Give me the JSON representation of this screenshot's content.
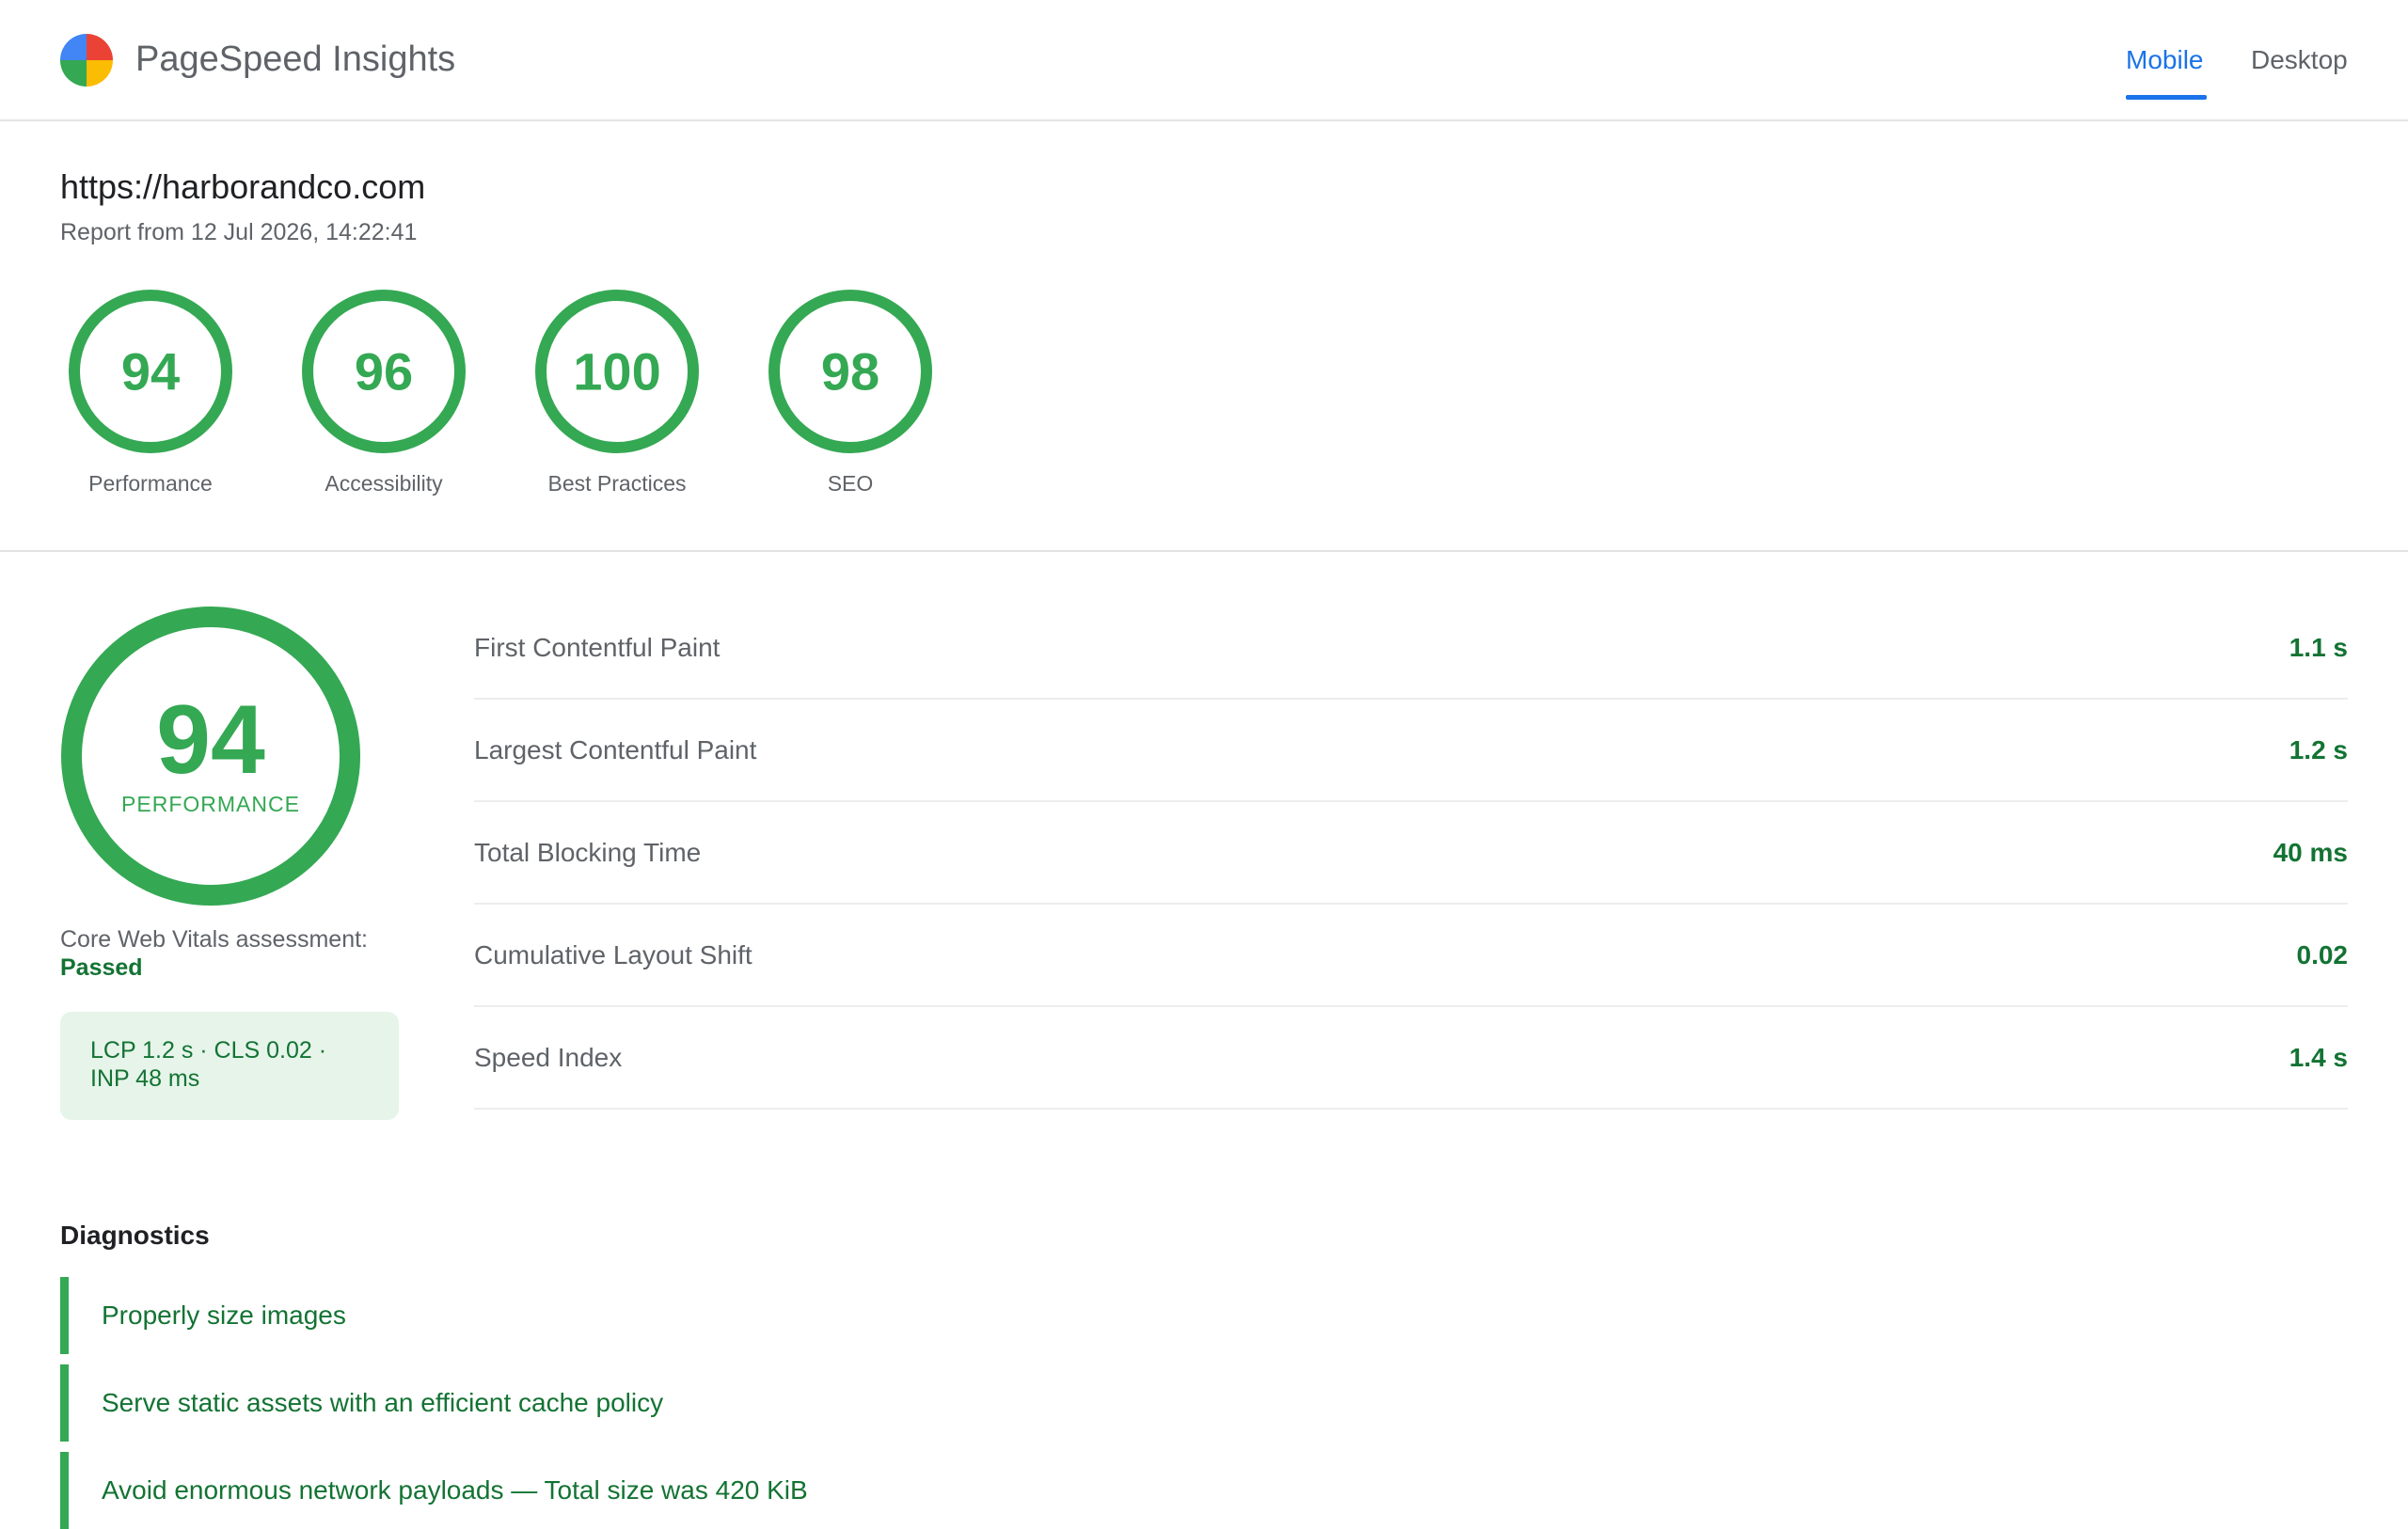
{
  "header": {
    "app_title": "PageSpeed Insights",
    "logo_icon": "pagespeed-logo-icon",
    "tabs": [
      {
        "label": "Mobile",
        "active": true
      },
      {
        "label": "Desktop",
        "active": false
      }
    ]
  },
  "report": {
    "url": "https://harborandco.com",
    "date": "Report from 12 Jul 2026, 14:22:41"
  },
  "categories": [
    {
      "score": "94",
      "label": "Performance"
    },
    {
      "score": "96",
      "label": "Accessibility"
    },
    {
      "score": "100",
      "label": "Best Practices"
    },
    {
      "score": "98",
      "label": "SEO"
    }
  ],
  "performance": {
    "score": "94",
    "caption": "PERFORMANCE",
    "cwv_label": "Core Web Vitals assessment:",
    "cwv_status": "Passed",
    "cwv_summary": "LCP 1.2 s · CLS 0.02 · INP 48 ms"
  },
  "metrics": [
    {
      "name": "First Contentful Paint",
      "value": "1.1 s"
    },
    {
      "name": "Largest Contentful Paint",
      "value": "1.2 s"
    },
    {
      "name": "Total Blocking Time",
      "value": "40 ms"
    },
    {
      "name": "Cumulative Layout Shift",
      "value": "0.02"
    },
    {
      "name": "Speed Index",
      "value": "1.4 s"
    }
  ],
  "diagnostics": {
    "title": "Diagnostics",
    "items": [
      "Properly size images",
      "Serve static assets with an efficient cache policy",
      "Avoid enormous network payloads — Total size was 420 KiB"
    ]
  },
  "colors": {
    "pass": "#34a853",
    "pass_text": "#137333",
    "accent": "#1a73e8"
  }
}
